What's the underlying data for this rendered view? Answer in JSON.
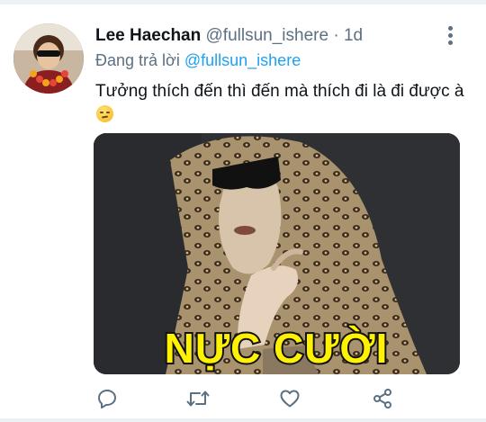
{
  "tweet": {
    "display_name": "Lee Haechan",
    "handle": "@fullsun_ishere",
    "separator": "·",
    "time": "1d",
    "reply_prefix": "Đang trả lời",
    "reply_to": "@fullsun_ishere",
    "text": "Tưởng thích đến thì đến mà thích đi là đi được à",
    "emoji": "smirking-face-emoji",
    "media_caption": "NỰC CƯỜI"
  },
  "icons": {
    "more": "more-vertical-icon",
    "reply": "reply-icon",
    "retweet": "retweet-icon",
    "like": "heart-icon",
    "share": "share-icon"
  },
  "colors": {
    "text": "#0f1419",
    "secondary": "#5b7083",
    "link": "#1da1f2",
    "caption_fill": "#fff200"
  }
}
